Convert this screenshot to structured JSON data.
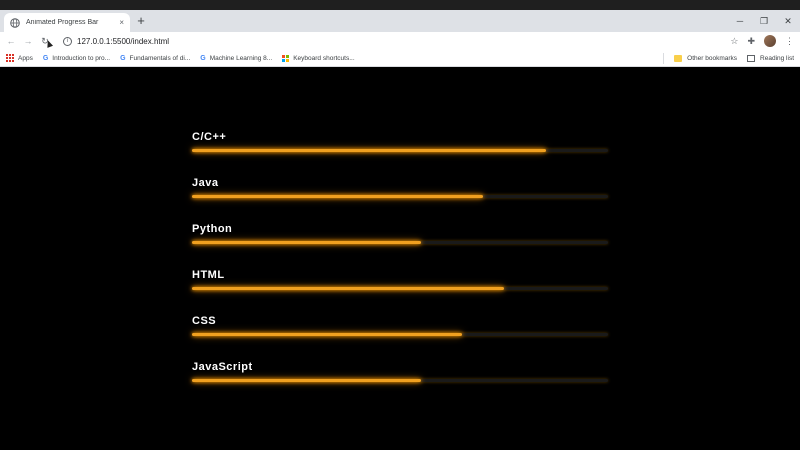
{
  "browser": {
    "tab_title": "Animated Progress Bar",
    "tab_close": "×",
    "new_tab": "+",
    "window_controls": [
      "─",
      "❐",
      "✕"
    ],
    "url": "127.0.0.1:5500/index.html",
    "bookmarks": [
      "Apps",
      "Introduction to pro...",
      "Fundamentals of di...",
      "Machine Learning 8...",
      "Keyboard shortcuts..."
    ],
    "other_bookmarks": "Other bookmarks",
    "reading_list": "Reading list"
  },
  "skills": [
    {
      "label": "C/C++",
      "progress": 0.85
    },
    {
      "label": "Java",
      "progress": 0.7
    },
    {
      "label": "Python",
      "progress": 0.55
    },
    {
      "label": "HTML",
      "progress": 0.75
    },
    {
      "label": "CSS",
      "progress": 0.65
    },
    {
      "label": "JavaScript",
      "progress": 0.55
    }
  ],
  "colors": {
    "background": "#000000",
    "bar_fill": "#f0a020",
    "glow": "#ff9d00"
  }
}
